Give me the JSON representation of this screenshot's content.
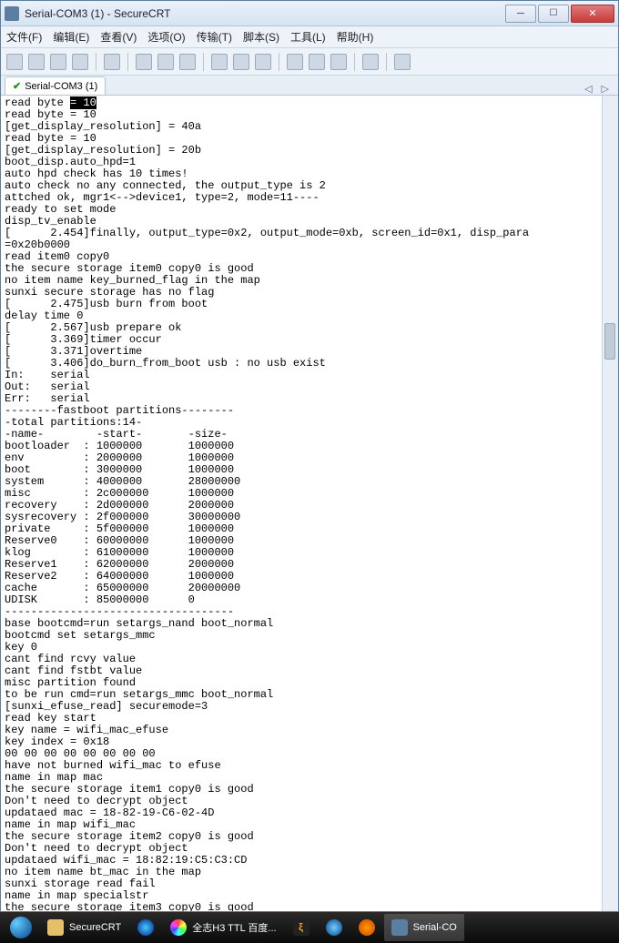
{
  "window": {
    "title": "Serial-COM3 (1) - SecureCRT"
  },
  "menu": {
    "file": "文件(F)",
    "edit": "编辑(E)",
    "view": "查看(V)",
    "options": "选项(O)",
    "transfer": "传输(T)",
    "script": "脚本(S)",
    "tools": "工具(L)",
    "help": "帮助(H)"
  },
  "tab": {
    "label": "Serial-COM3 (1)"
  },
  "terminal": {
    "highlight_prefix": "read byte ",
    "highlight_text": "= 10",
    "lines": [
      "read byte = 10",
      "[get_display_resolution] = 40a",
      "read byte = 10",
      "[get_display_resolution] = 20b",
      "boot_disp.auto_hpd=1",
      "auto hpd check has 10 times!",
      "auto check no any connected, the output_type is 2",
      "attched ok, mgr1<-->device1, type=2, mode=11----",
      "ready to set mode",
      "disp_tv_enable",
      "[      2.454]finally, output_type=0x2, output_mode=0xb, screen_id=0x1, disp_para",
      "=0x20b0000",
      "read item0 copy0",
      "the secure storage item0 copy0 is good",
      "no item name key_burned_flag in the map",
      "sunxi secure storage has no flag",
      "[      2.475]usb burn from boot",
      "delay time 0",
      "[      2.567]usb prepare ok",
      "[      3.369]timer occur",
      "[      3.371]overtime",
      "[      3.406]do_burn_from_boot usb : no usb exist",
      "In:    serial",
      "Out:   serial",
      "Err:   serial",
      "--------fastboot partitions--------",
      "-total partitions:14-",
      "-name-        -start-       -size-",
      "bootloader  : 1000000       1000000",
      "env         : 2000000       1000000",
      "boot        : 3000000       1000000",
      "system      : 4000000       28000000",
      "misc        : 2c000000      1000000",
      "recovery    : 2d000000      2000000",
      "sysrecovery : 2f000000      30000000",
      "private     : 5f000000      1000000",
      "Reserve0    : 60000000      1000000",
      "klog        : 61000000      1000000",
      "Reserve1    : 62000000      2000000",
      "Reserve2    : 64000000      1000000",
      "cache       : 65000000      20000000",
      "UDISK       : 85000000      0",
      "-----------------------------------",
      "base bootcmd=run setargs_nand boot_normal",
      "bootcmd set setargs_mmc",
      "key 0",
      "cant find rcvy value",
      "cant find fstbt value",
      "misc partition found",
      "to be run cmd=run setargs_mmc boot_normal",
      "[sunxi_efuse_read] securemode=3",
      "read key start",
      "key name = wifi_mac_efuse",
      "key index = 0x18",
      "00 00 00 00 00 00 00 00",
      "have not burned wifi_mac to efuse",
      "name in map mac",
      "the secure storage item1 copy0 is good",
      "Don't need to decrypt object",
      "updataed mac = 18-82-19-C6-02-4D",
      "name in map wifi_mac",
      "the secure storage item2 copy0 is good",
      "Don't need to decrypt object",
      "updataed wifi_mac = 18:82:19:C5:C3:CD",
      "no item name bt_mac in the map",
      "sunxi storage read fail",
      "name in map specialstr",
      "the secure storage item3 copy0 is good"
    ]
  },
  "taskbar": {
    "securecrt": "SecureCRT",
    "browser_tab": "全志H3 TTL 百度...",
    "serial_task": "Serial-CO"
  }
}
